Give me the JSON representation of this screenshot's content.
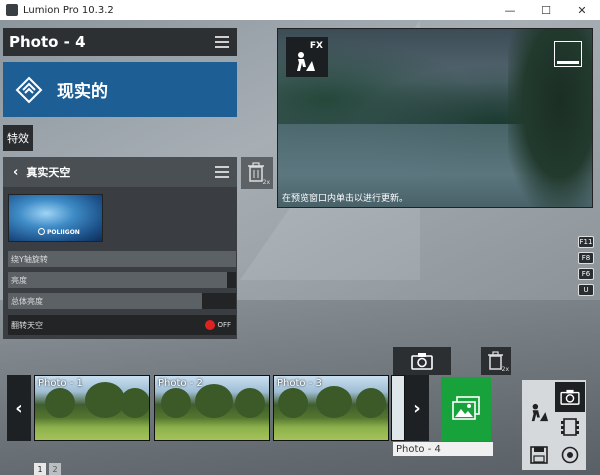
{
  "window": {
    "title": "Lumion Pro 10.3.2",
    "minimize": "—",
    "maximize": "☐",
    "close": "✕"
  },
  "panel": {
    "title": "Photo - 4"
  },
  "banner": {
    "label": "现实的"
  },
  "effects_tab": {
    "label": "特效"
  },
  "sky_panel": {
    "title": "真实天空",
    "thumbnail_brand": "POLIIGON",
    "sliders": [
      {
        "label": "绕Y轴旋转",
        "level": 1.0
      },
      {
        "label": "亮度",
        "level": 0.96
      },
      {
        "label": "总体亮度",
        "level": 0.85
      }
    ],
    "toggle": {
      "label": "翻转天空",
      "state": "OFF"
    }
  },
  "trash": {
    "badge": "2x"
  },
  "preview": {
    "fx_label": "FX",
    "hint": "在预览窗口内单击以进行更新。"
  },
  "function_keys": [
    "F11",
    "F8",
    "F6",
    "U"
  ],
  "photos": [
    {
      "label": "Photo - 1"
    },
    {
      "label": "Photo - 2"
    },
    {
      "label": "Photo - 3"
    }
  ],
  "current_photo_label": "Photo - 4",
  "nav": {
    "prev": "‹",
    "next": "›"
  },
  "pager": [
    "1",
    "2"
  ],
  "colors": {
    "banner": "#1d5f95",
    "add_photo": "#17a23b",
    "toggle_off": "#dd2222"
  }
}
